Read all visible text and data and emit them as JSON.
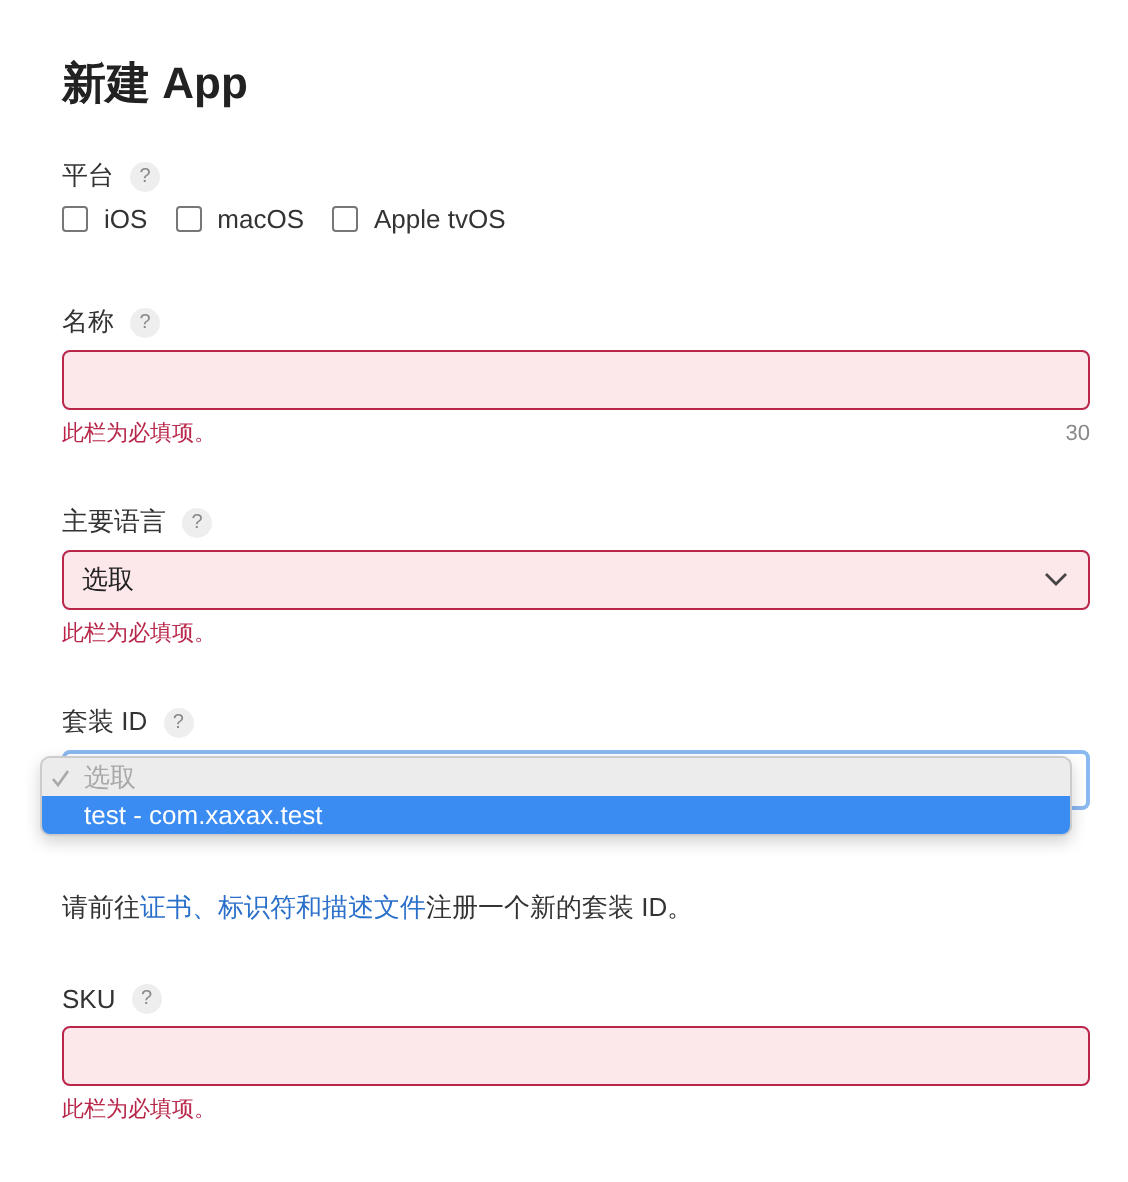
{
  "title": "新建 App",
  "platform": {
    "label": "平台",
    "help": "?",
    "options": [
      {
        "label": "iOS",
        "checked": false
      },
      {
        "label": "macOS",
        "checked": false
      },
      {
        "label": "Apple tvOS",
        "checked": false
      }
    ]
  },
  "fields": [
    {
      "kind": "text",
      "label": "名称",
      "help": "?",
      "invalid": true,
      "error": "此栏为必填项。",
      "counter": "30"
    },
    {
      "kind": "select",
      "label": "主要语言",
      "help": "?",
      "invalid": true,
      "value": "选取",
      "error": "此栏为必填项。"
    },
    {
      "kind": "dropdown",
      "label": "套装 ID",
      "help": "?",
      "invalid": false,
      "menu": [
        {
          "label": "选取",
          "checked": true,
          "disabled": true,
          "highlighted": false
        },
        {
          "label": "test - com.xaxax.test",
          "checked": false,
          "disabled": false,
          "highlighted": true
        }
      ],
      "note": {
        "before": "请前往",
        "link": "证书、标识符和描述文件",
        "after": "注册一个新的套装 ID。"
      }
    },
    {
      "kind": "text",
      "label": "SKU",
      "help": "?",
      "invalid": true,
      "error": "此栏为必填项。"
    }
  ]
}
